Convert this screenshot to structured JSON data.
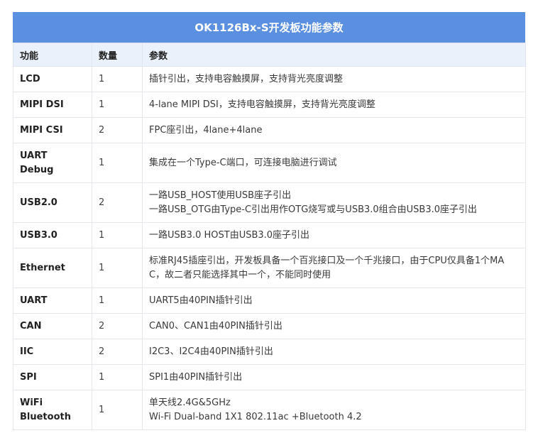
{
  "title": "OK1126Bx-S开发板功能参数",
  "headers": {
    "feature": "功能",
    "qty": "数量",
    "params": "参数"
  },
  "rows": [
    {
      "feature": [
        "LCD"
      ],
      "qty": "1",
      "params": [
        "插针引出，支持电容触摸屏，支持背光亮度调整"
      ]
    },
    {
      "feature": [
        "MIPI DSI"
      ],
      "qty": "1",
      "params": [
        "4-lane MIPI DSI，支持电容触摸屏，支持背光亮度调整"
      ]
    },
    {
      "feature": [
        "MIPI CSI"
      ],
      "qty": "2",
      "params": [
        "FPC座引出，4lane+4lane"
      ]
    },
    {
      "feature": [
        "UART",
        "Debug"
      ],
      "qty": "1",
      "params": [
        "集成在一个Type-C端口，可连接电脑进行调试"
      ]
    },
    {
      "feature": [
        "USB2.0"
      ],
      "qty": "2",
      "params": [
        "一路USB_HOST使用USB座子引出",
        "一路USB_OTG由Type-C引出用作OTG烧写或与USB3.0组合由USB3.0座子引出"
      ]
    },
    {
      "feature": [
        "USB3.0"
      ],
      "qty": "1",
      "params": [
        "一路USB3.0 HOST由USB3.0座子引出"
      ]
    },
    {
      "feature": [
        "Ethernet"
      ],
      "qty": "1",
      "params": [
        "标准RJ45插座引出，开发板具备一个百兆接口及一个千兆接口，由于CPU仅具备1个MA",
        "C，故二者只能选择其中一个，不能同时使用"
      ]
    },
    {
      "feature": [
        "UART"
      ],
      "qty": "1",
      "params": [
        "UART5由40PIN插针引出"
      ]
    },
    {
      "feature": [
        "CAN"
      ],
      "qty": "2",
      "params": [
        "CAN0、CAN1由40PIN插针引出"
      ]
    },
    {
      "feature": [
        "IIC"
      ],
      "qty": "2",
      "params": [
        "I2C3、I2C4由40PIN插针引出"
      ]
    },
    {
      "feature": [
        "SPI"
      ],
      "qty": "1",
      "params": [
        "SPI1由40PIN插针引出"
      ]
    },
    {
      "feature": [
        "WiFi",
        "Bluetooth"
      ],
      "qty": "1",
      "params": [
        "单天线2.4G&5GHz",
        "Wi-Fi Dual-band 1X1 802.11ac +Bluetooth 4.2"
      ]
    }
  ]
}
